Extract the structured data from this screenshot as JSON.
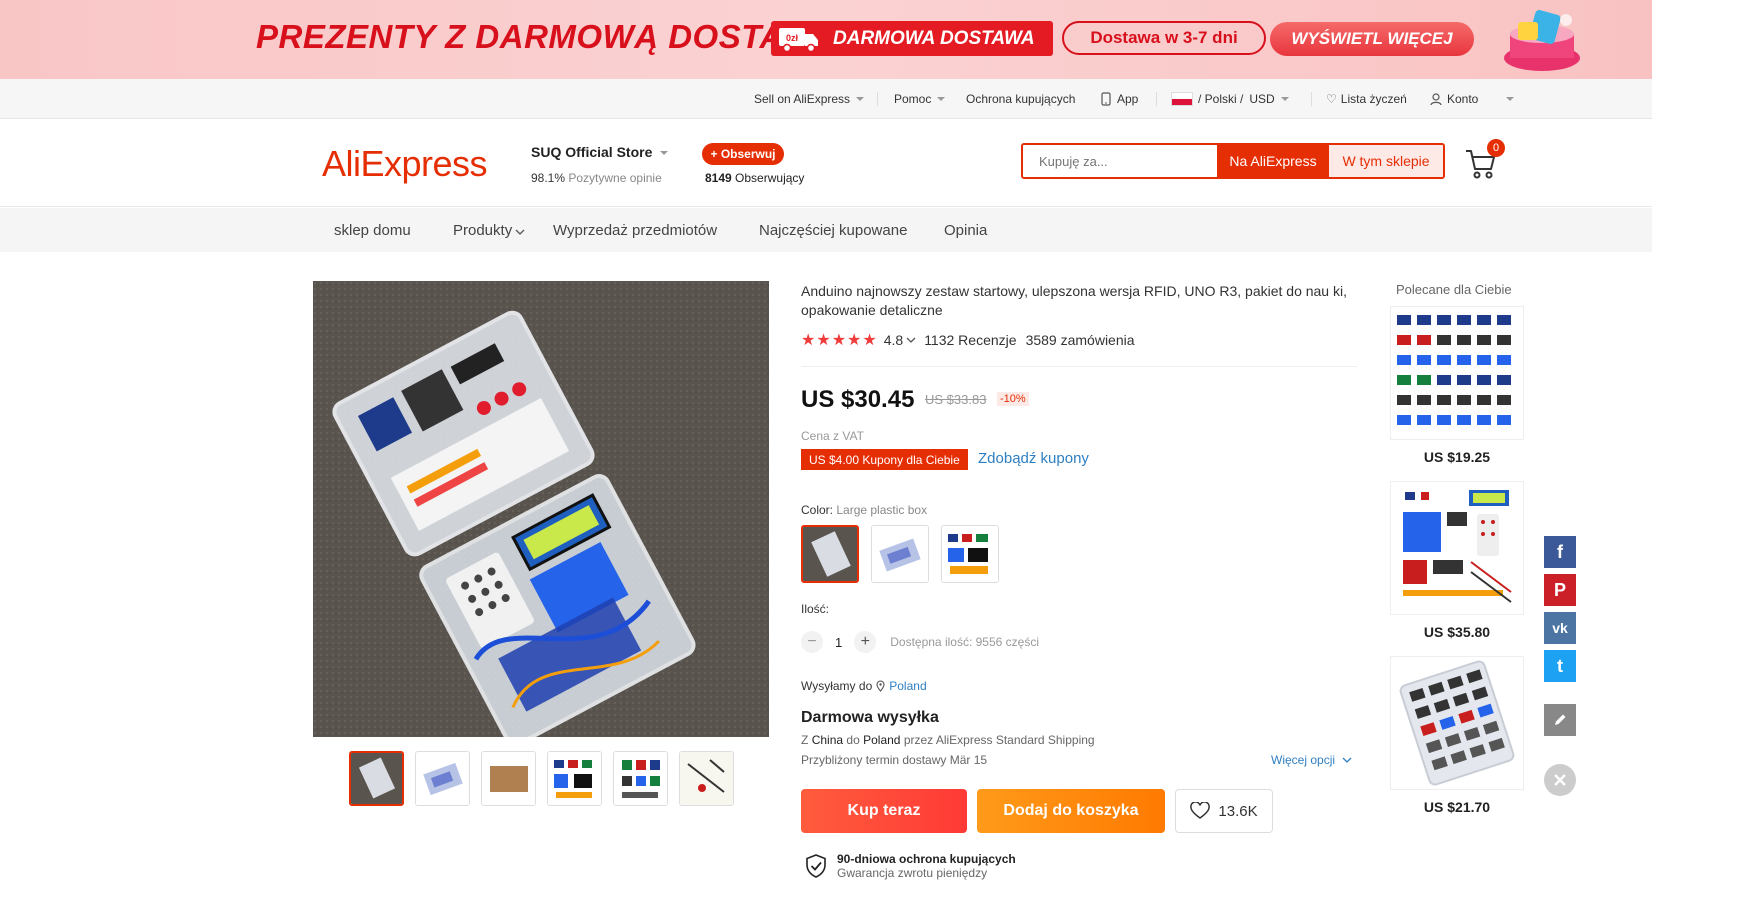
{
  "promo": {
    "headline": "PREZENTY Z DARMOWĄ DOSTAWĄ",
    "truck_label": "0zł",
    "free_delivery": "DARMOWA DOSTAWA",
    "delivery_time": "Dostawa w 3-7 dni",
    "show_more": "WYŚWIETL WIĘCEJ"
  },
  "topbar": {
    "sell": "Sell on AliExpress",
    "help": "Pomoc",
    "buyer_protection": "Ochrona kupujących",
    "app": "App",
    "locale": "/ Polski /",
    "currency": "USD",
    "wishlist": "Lista życzeń",
    "account": "Konto"
  },
  "header": {
    "logo": "AliExpress",
    "store_name": "SUQ Official Store",
    "positive_pct": "98.1%",
    "positive_label": "Pozytywne opinie",
    "follow_label": "+ Obserwuj",
    "followers_count": "8149",
    "followers_label": "Obserwujący",
    "search_placeholder": "Kupuję za...",
    "search_ali": "Na AliExpress",
    "search_store": "W tym sklepie",
    "cart_count": "0"
  },
  "nav": {
    "items": [
      "sklep domu",
      "Produkty",
      "Wyprzedaż przedmiotów",
      "Najczęściej kupowane",
      "Opinia"
    ]
  },
  "product": {
    "title": "Anduino najnowszy zestaw startowy, ulepszona wersja RFID, UNO R3, pakiet do nau ki, opakowanie detaliczne",
    "rating": "4.8",
    "reviews": "1132 Recenzje",
    "orders": "3589 zamówienia",
    "price": "US $30.45",
    "old_price": "US $33.83",
    "discount": "-10%",
    "vat": "Cena z VAT",
    "coupon": "US $4.00 Kupony dla Ciebie",
    "coupon_link": "Zdobądź kupony",
    "color_label": "Color:",
    "color_value": "Large plastic box",
    "qty_label": "Ilość:",
    "qty_value": "1",
    "available": "Dostępna ilość: 9556 części",
    "ship_to_label": "Wysyłamy do",
    "ship_to_country": "Poland",
    "free_shipping": "Darmowa wysyłka",
    "route_prefix": "Z",
    "route_from": "China",
    "route_mid": "do",
    "route_to": "Poland",
    "route_suffix": "przez AliExpress Standard Shipping",
    "eta": "Przybliżony termin dostawy Mär 15",
    "more_options": "Więcej opcji",
    "buy_now": "Kup teraz",
    "add_to_cart": "Dodaj do koszyka",
    "wish_count": "13.6K",
    "protection_title": "90-dniowa ochrona kupujących",
    "protection_sub": "Gwarancja zwrotu pieniędzy"
  },
  "recommended": {
    "title": "Polecane dla Ciebie",
    "items": [
      {
        "price": "US $19.25"
      },
      {
        "price": "US $35.80"
      },
      {
        "price": "US $21.70"
      }
    ]
  },
  "social": {
    "facebook": "f",
    "pinterest": "P",
    "vk": "vk",
    "twitter": "t"
  },
  "colors": {
    "accent": "#e62e04",
    "link": "#2e7fc2",
    "buy": "#ff4747",
    "cart": "#ff8c0a",
    "facebook": "#3b5998",
    "pinterest": "#cb2027",
    "vk": "#4c75a3",
    "twitter": "#1da1f2",
    "edit": "#888888"
  }
}
